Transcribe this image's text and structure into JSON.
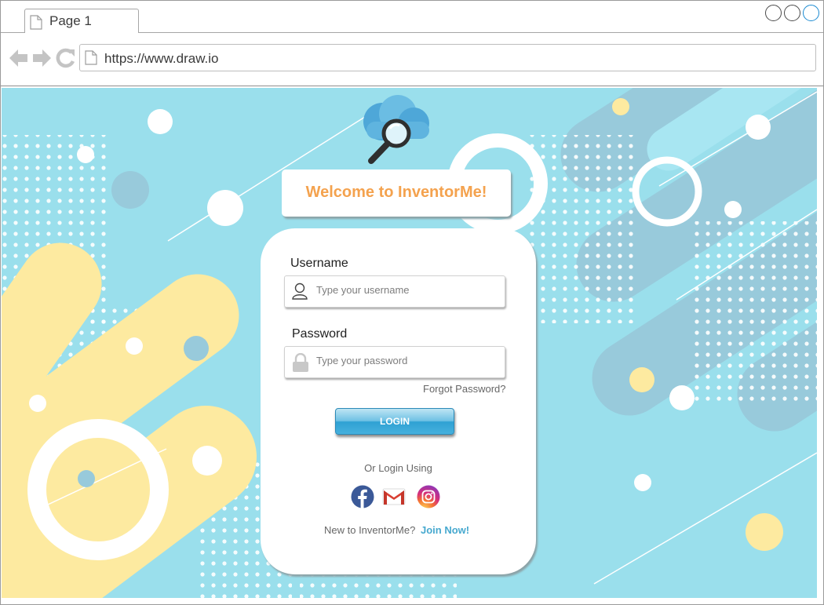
{
  "tab": {
    "title": "Page 1",
    "icon": "document-icon"
  },
  "window_controls": [
    "minimize-circle",
    "maximize-circle",
    "close-circle"
  ],
  "nav": {
    "url": "https://www.draw.io",
    "back_icon": "arrow-left-icon",
    "forward_icon": "arrow-right-icon",
    "reload_icon": "reload-icon"
  },
  "app": {
    "welcome": "Welcome to InventorMe!",
    "username_label": "Username",
    "username_placeholder": "Type your username",
    "password_label": "Password",
    "password_placeholder": "Type your password",
    "forgot": "Forgot Password?",
    "login": "LOGIN",
    "or_login": "Or Login Using",
    "social": [
      "facebook-icon",
      "gmail-icon",
      "instagram-icon"
    ],
    "new_user": "New to InventorMe?",
    "join": "Join Now!"
  },
  "colors": {
    "background": "#9adfec",
    "accent": "#f4a24e",
    "link": "#47a9cf",
    "button": "#2fa1d3",
    "blob_yellow": "#fdeaa0",
    "blob_blue": "#98cadb"
  }
}
